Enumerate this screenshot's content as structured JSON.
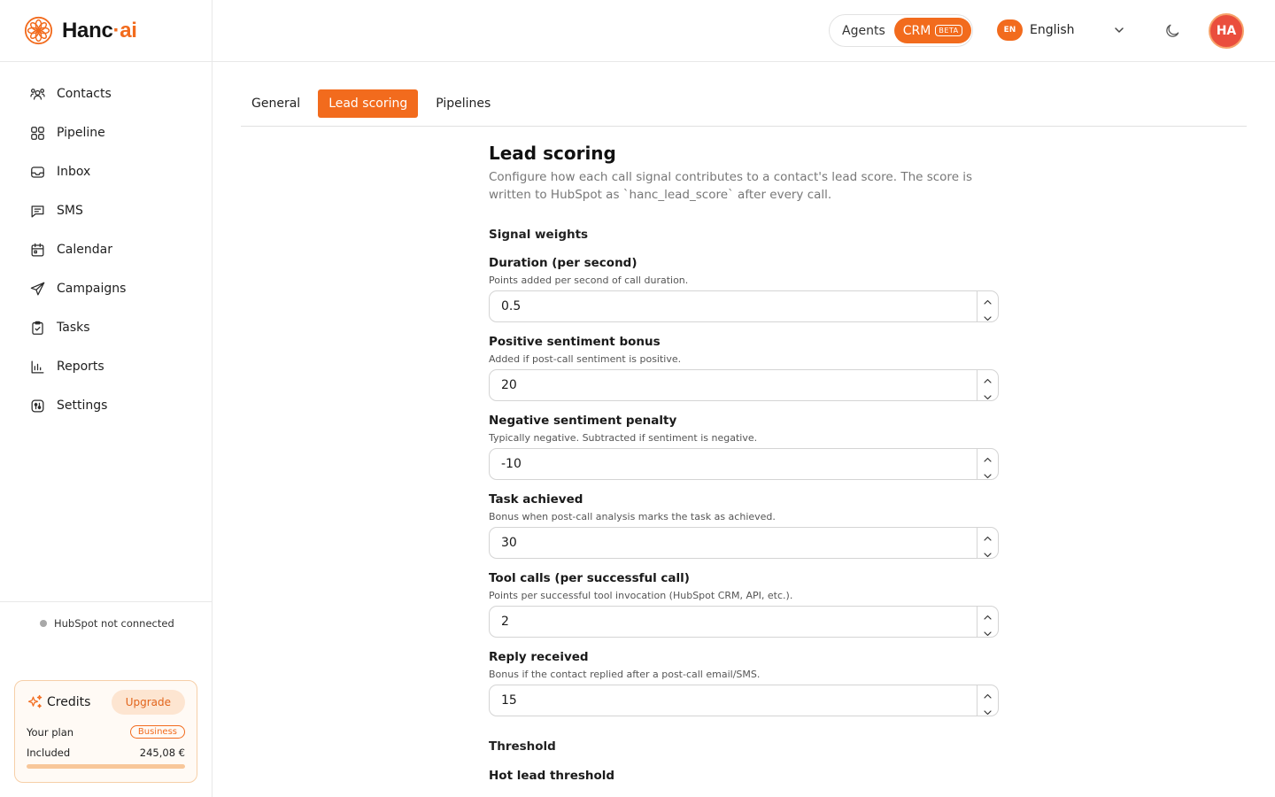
{
  "brand": {
    "name_part1": "Hanc",
    "name_dot": "·",
    "name_part2": "ai"
  },
  "header": {
    "mode_agents": "Agents",
    "mode_crm": "CRM",
    "mode_crm_badge": "BETA",
    "lang_code": "EN",
    "lang_label": "English",
    "avatar_initials": "HA"
  },
  "sidebar": {
    "items": [
      {
        "label": "Contacts",
        "icon": "contacts-icon"
      },
      {
        "label": "Pipeline",
        "icon": "pipeline-icon"
      },
      {
        "label": "Inbox",
        "icon": "inbox-icon"
      },
      {
        "label": "SMS",
        "icon": "sms-icon"
      },
      {
        "label": "Calendar",
        "icon": "calendar-icon"
      },
      {
        "label": "Campaigns",
        "icon": "campaigns-icon"
      },
      {
        "label": "Tasks",
        "icon": "tasks-icon"
      },
      {
        "label": "Reports",
        "icon": "reports-icon"
      },
      {
        "label": "Settings",
        "icon": "settings-icon"
      }
    ],
    "hubspot_status": "HubSpot not connected",
    "credits": {
      "title": "Credits",
      "upgrade_label": "Upgrade",
      "plan_label": "Your plan",
      "plan_name": "Business",
      "included_label": "Included",
      "included_value": "245,08 €",
      "progress_fraction": 1.0
    }
  },
  "tabs": [
    {
      "label": "General",
      "active": false
    },
    {
      "label": "Lead scoring",
      "active": true
    },
    {
      "label": "Pipelines",
      "active": false
    }
  ],
  "main": {
    "title": "Lead scoring",
    "description": "Configure how each call signal contributes to a contact's lead score. The score is written to HubSpot as `hanc_lead_score` after every call.",
    "signal_weights_title": "Signal weights",
    "fields": [
      {
        "label": "Duration (per second)",
        "help": "Points added per second of call duration.",
        "value": "0.5"
      },
      {
        "label": "Positive sentiment bonus",
        "help": "Added if post-call sentiment is positive.",
        "value": "20"
      },
      {
        "label": "Negative sentiment penalty",
        "help": "Typically negative. Subtracted if sentiment is negative.",
        "value": "-10"
      },
      {
        "label": "Task achieved",
        "help": "Bonus when post-call analysis marks the task as achieved.",
        "value": "30"
      },
      {
        "label": "Tool calls (per successful call)",
        "help": "Points per successful tool invocation (HubSpot CRM, API, etc.).",
        "value": "2"
      },
      {
        "label": "Reply received",
        "help": "Bonus if the contact replied after a post-call email/SMS.",
        "value": "15"
      }
    ],
    "threshold_title": "Threshold",
    "hot_lead_label": "Hot lead threshold"
  },
  "colors": {
    "accent": "#f26b1d",
    "avatar": "#ea4e3d"
  }
}
